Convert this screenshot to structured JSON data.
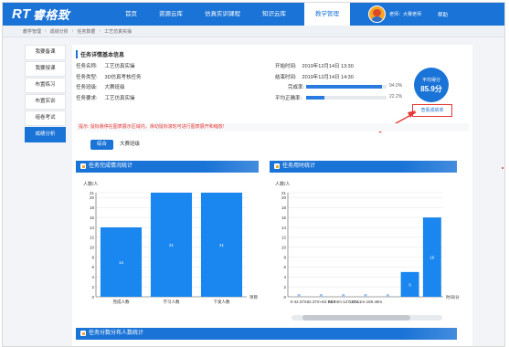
{
  "brand": {
    "logo_rt": "RT",
    "logo_text": "睿格致"
  },
  "nav": {
    "items": [
      {
        "label": "首页"
      },
      {
        "label": "资源云库"
      },
      {
        "label": "仿真实训课程"
      },
      {
        "label": "知识云库"
      },
      {
        "label": "教学管理",
        "active": true
      }
    ]
  },
  "user": {
    "name": "老师：大赛老师",
    "help": "帮助"
  },
  "breadcrumb": [
    "教学管理",
    "成绩分析",
    "任务数据",
    "工艺仿真实操"
  ],
  "sidebar": {
    "items": [
      {
        "label": "我要备课"
      },
      {
        "label": "我要授课"
      },
      {
        "label": "布置练习"
      },
      {
        "label": "布置实训"
      },
      {
        "label": "组卷考试"
      },
      {
        "label": "成绩分析",
        "active": true
      }
    ]
  },
  "task_info": {
    "section_title": "任务详情基本信息",
    "name_label": "任务名称:",
    "name": "工艺仿真实操",
    "type_label": "任务类型:",
    "type": "3D仿真考核任务",
    "class_label": "任务班级:",
    "class": "大赛班级",
    "req_label": "任务要求:",
    "req": "工艺仿真实操",
    "start_label": "开始时间:",
    "start": "2019年12月14日 13:30",
    "end_label": "结束时间:",
    "end": "2019年12月14日 14:30",
    "completion_label": "完成率:",
    "completion_pct": "94.0%",
    "completion_value": 0.94,
    "accuracy_label": "平均正确率:",
    "accuracy_pct": "22.2%",
    "accuracy_value": 0.222,
    "avg_label": "平均得分",
    "avg_value": "85.9分",
    "report_button": "查看成绩单"
  },
  "hint": "提示: 鼠标悬停在图表展示区域内，滑动鼠标滚轮可进行图表展开和缩放!",
  "tabs": [
    {
      "label": "综合",
      "active": true
    },
    {
      "label": "大赛班级"
    }
  ],
  "panels": {
    "completion_title": "任务完成情况统计",
    "time_title": "任务用时统计",
    "score_title": "任务分数分布人数统计"
  },
  "chart_data": [
    {
      "type": "bar",
      "title": "任务完成情况统计",
      "ylabel": "人数/人",
      "xlabel": "项目",
      "categories": [
        "完成人数",
        "学习人数",
        "下发人数"
      ],
      "values": [
        14,
        21,
        21
      ],
      "ylim": [
        0,
        21
      ],
      "yticks": [
        0,
        2,
        4,
        6,
        8,
        10,
        12,
        14,
        16,
        18,
        20,
        21
      ],
      "color": "#1a86f0"
    },
    {
      "type": "bar",
      "title": "任务用时统计",
      "ylabel": "人数/人",
      "xlabel": "时间/分",
      "categories": [
        "0-42.37m",
        "42.37m-84.74m",
        "84.74m-127.11m",
        "127.11m-169.48m",
        "",
        "",
        ""
      ],
      "values": [
        0,
        0,
        0,
        0,
        0,
        5,
        16
      ],
      "ylim": [
        0,
        21
      ],
      "yticks": [
        0,
        2,
        4,
        6,
        8,
        10,
        12,
        14,
        16,
        18,
        20,
        21
      ],
      "color": "#1a86f0"
    }
  ]
}
